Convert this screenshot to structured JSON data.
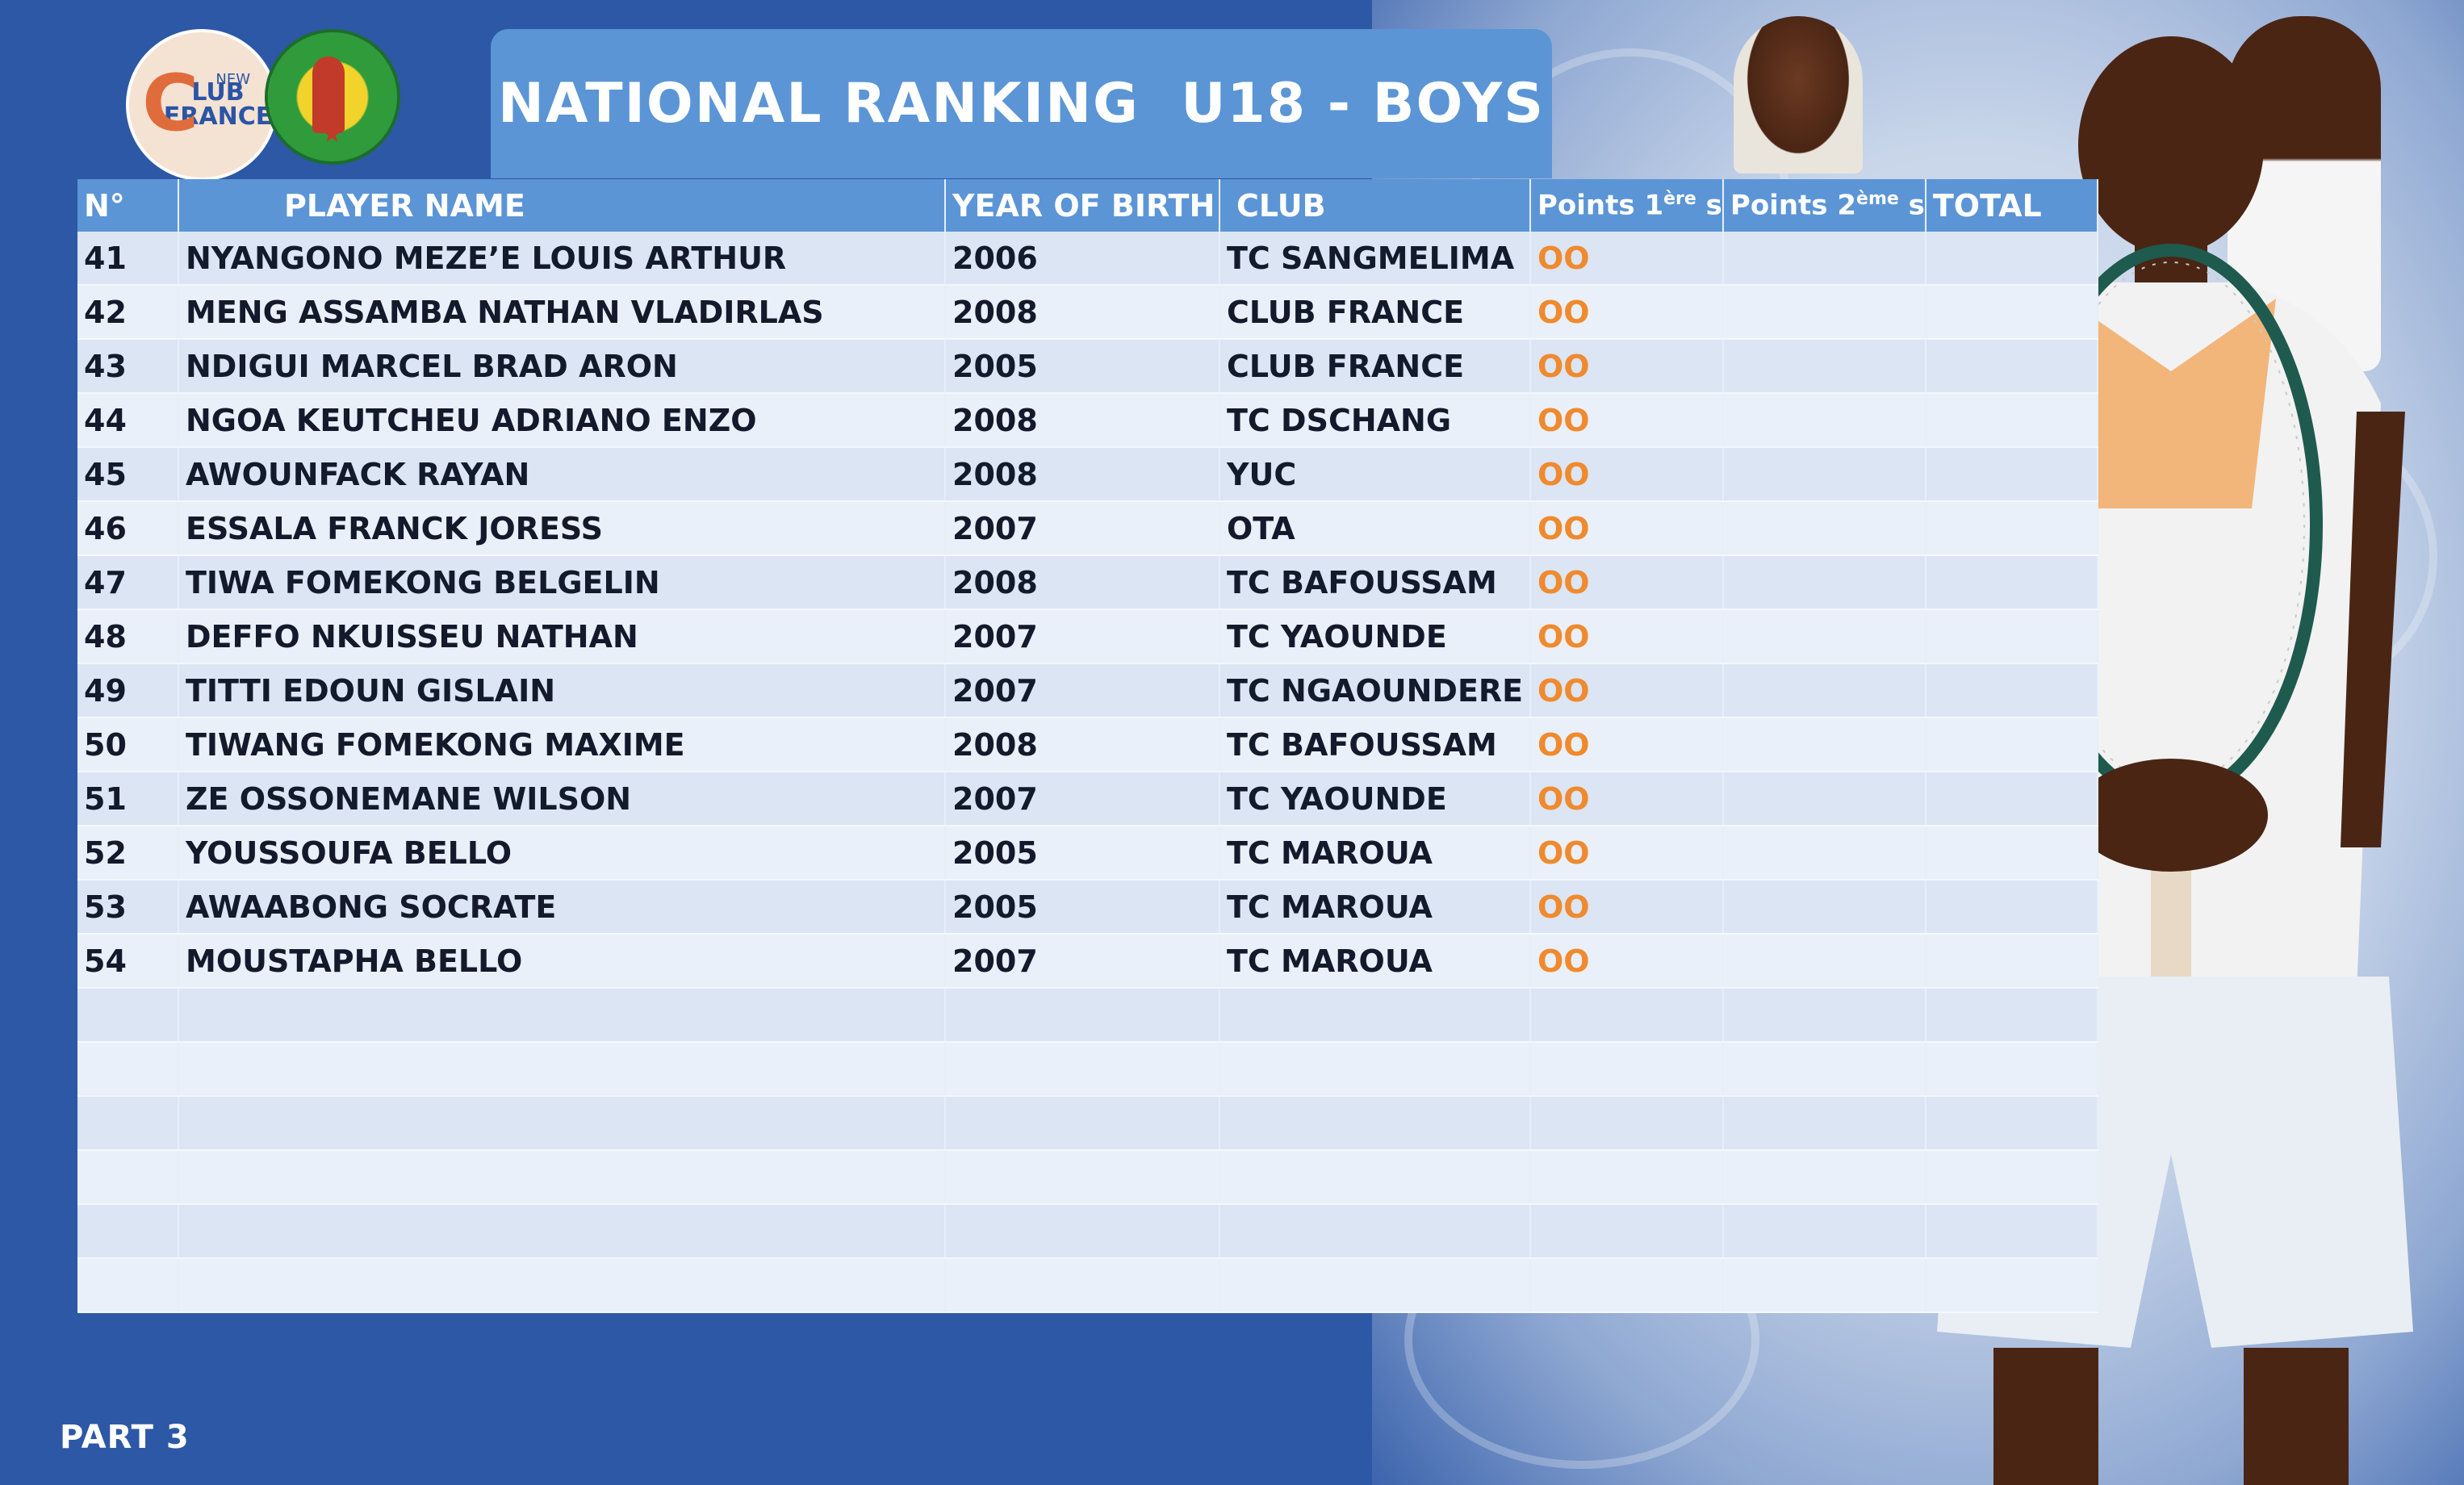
{
  "title": "NATIONAL RANKING  U18 - BOYS",
  "logos": {
    "club_france": {
      "new": "NEW",
      "c": "C",
      "line1": "LUB",
      "line2": "FRANCE"
    }
  },
  "part_label": "PART 3",
  "table": {
    "headers": {
      "num": "N°",
      "name": "PLAYER NAME",
      "yob": "YEAR OF BIRTH",
      "club": "CLUB",
      "pts1_main": "Points 1",
      "pts1_sup": "ère",
      "pts1_tail": " s",
      "pts2_main": "Points 2",
      "pts2_sup": "ème",
      "pts2_tail": " s",
      "total": "TOTAL"
    },
    "rows": [
      {
        "num": "41",
        "name": "NYANGONO MEZE’E LOUIS ARTHUR",
        "yob": "2006",
        "club": "TC SANGMELIMA",
        "pts1": "OO",
        "pts2": "",
        "total": ""
      },
      {
        "num": "42",
        "name": "MENG ASSAMBA NATHAN VLADIRLAS",
        "yob": "2008",
        "club": "CLUB FRANCE",
        "pts1": "OO",
        "pts2": "",
        "total": ""
      },
      {
        "num": "43",
        "name": "NDIGUI MARCEL BRAD ARON",
        "yob": "2005",
        "club": "CLUB FRANCE",
        "pts1": "OO",
        "pts2": "",
        "total": ""
      },
      {
        "num": "44",
        "name": "NGOA KEUTCHEU ADRIANO ENZO",
        "yob": "2008",
        "club": "TC DSCHANG",
        "pts1": "OO",
        "pts2": "",
        "total": ""
      },
      {
        "num": "45",
        "name": "AWOUNFACK RAYAN",
        "yob": "2008",
        "club": "YUC",
        "pts1": "OO",
        "pts2": "",
        "total": ""
      },
      {
        "num": "46",
        "name": "ESSALA FRANCK JORESS",
        "yob": "2007",
        "club": "OTA",
        "pts1": "OO",
        "pts2": "",
        "total": ""
      },
      {
        "num": "47",
        "name": "TIWA FOMEKONG BELGELIN",
        "yob": "2008",
        "club": "TC BAFOUSSAM",
        "pts1": "OO",
        "pts2": "",
        "total": ""
      },
      {
        "num": "48",
        "name": "DEFFO NKUISSEU NATHAN",
        "yob": "2007",
        "club": "TC YAOUNDE",
        "pts1": "OO",
        "pts2": "",
        "total": ""
      },
      {
        "num": "49",
        "name": "TITTI EDOUN GISLAIN",
        "yob": "2007",
        "club": "TC NGAOUNDERE",
        "pts1": "OO",
        "pts2": "",
        "total": ""
      },
      {
        "num": "50",
        "name": "TIWANG FOMEKONG MAXIME",
        "yob": "2008",
        "club": "TC BAFOUSSAM",
        "pts1": "OO",
        "pts2": "",
        "total": ""
      },
      {
        "num": "51",
        "name": "ZE OSSONEMANE WILSON",
        "yob": "2007",
        "club": "TC YAOUNDE",
        "pts1": "OO",
        "pts2": "",
        "total": ""
      },
      {
        "num": "52",
        "name": "YOUSSOUFA BELLO",
        "yob": "2005",
        "club": "TC MAROUA",
        "pts1": "OO",
        "pts2": "",
        "total": ""
      },
      {
        "num": "53",
        "name": "AWAABONG SOCRATE",
        "yob": "2005",
        "club": "TC MAROUA",
        "pts1": "OO",
        "pts2": "",
        "total": ""
      },
      {
        "num": "54",
        "name": "MOUSTAPHA BELLO",
        "yob": "2007",
        "club": "TC MAROUA",
        "pts1": "OO",
        "pts2": "",
        "total": ""
      },
      {
        "num": "",
        "name": "",
        "yob": "",
        "club": "",
        "pts1": "",
        "pts2": "",
        "total": ""
      },
      {
        "num": "",
        "name": "",
        "yob": "",
        "club": "",
        "pts1": "",
        "pts2": "",
        "total": ""
      },
      {
        "num": "",
        "name": "",
        "yob": "",
        "club": "",
        "pts1": "",
        "pts2": "",
        "total": ""
      },
      {
        "num": "",
        "name": "",
        "yob": "",
        "club": "",
        "pts1": "",
        "pts2": "",
        "total": ""
      },
      {
        "num": "",
        "name": "",
        "yob": "",
        "club": "",
        "pts1": "",
        "pts2": "",
        "total": ""
      },
      {
        "num": "",
        "name": "",
        "yob": "",
        "club": "",
        "pts1": "",
        "pts2": "",
        "total": ""
      }
    ]
  },
  "colors": {
    "background": "#2d58a6",
    "header": "#5b95d6",
    "row_odd": "#dbe5f4",
    "row_even": "#eaf0f9",
    "points": "#f08a2e"
  }
}
